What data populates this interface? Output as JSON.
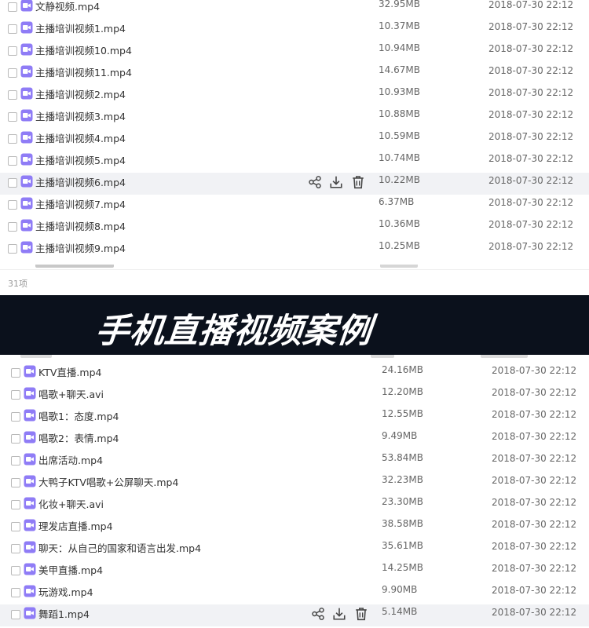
{
  "colors": {
    "file_icon": "#8f7cf6",
    "row_hover": "#f1f2f5",
    "banner_bg": "#0b111c",
    "text_primary": "#333333",
    "text_secondary": "#666666"
  },
  "top_list": {
    "files": [
      {
        "name": "文静视频.mp4",
        "size": "32.95MB",
        "date": "2018-07-30 22:12"
      },
      {
        "name": "主播培训视频1.mp4",
        "size": "10.37MB",
        "date": "2018-07-30 22:12"
      },
      {
        "name": "主播培训视频10.mp4",
        "size": "10.94MB",
        "date": "2018-07-30 22:12"
      },
      {
        "name": "主播培训视频11.mp4",
        "size": "14.67MB",
        "date": "2018-07-30 22:12"
      },
      {
        "name": "主播培训视频2.mp4",
        "size": "10.93MB",
        "date": "2018-07-30 22:12"
      },
      {
        "name": "主播培训视频3.mp4",
        "size": "10.88MB",
        "date": "2018-07-30 22:12"
      },
      {
        "name": "主播培训视频4.mp4",
        "size": "10.59MB",
        "date": "2018-07-30 22:12"
      },
      {
        "name": "主播培训视频5.mp4",
        "size": "10.74MB",
        "date": "2018-07-30 22:12"
      },
      {
        "name": "主播培训视频6.mp4",
        "size": "10.22MB",
        "date": "2018-07-30 22:12",
        "hover": true
      },
      {
        "name": "主播培训视频7.mp4",
        "size": "6.37MB",
        "date": "2018-07-30 22:12"
      },
      {
        "name": "主播培训视频8.mp4",
        "size": "10.36MB",
        "date": "2018-07-30 22:12"
      },
      {
        "name": "主播培训视频9.mp4",
        "size": "10.25MB",
        "date": "2018-07-30 22:12"
      }
    ],
    "item_count": "31项"
  },
  "banner": {
    "title": "手机直播视频案例"
  },
  "bottom_list": {
    "files": [
      {
        "name": "KTV直播.mp4",
        "size": "24.16MB",
        "date": "2018-07-30 22:12"
      },
      {
        "name": "唱歌+聊天.avi",
        "size": "12.20MB",
        "date": "2018-07-30 22:12"
      },
      {
        "name": "唱歌1：态度.mp4",
        "size": "12.55MB",
        "date": "2018-07-30 22:12"
      },
      {
        "name": "唱歌2：表情.mp4",
        "size": "9.49MB",
        "date": "2018-07-30 22:12"
      },
      {
        "name": "出席活动.mp4",
        "size": "53.84MB",
        "date": "2018-07-30 22:12"
      },
      {
        "name": "大鸭子KTV唱歌+公屏聊天.mp4",
        "size": "32.23MB",
        "date": "2018-07-30 22:12"
      },
      {
        "name": "化妆+聊天.avi",
        "size": "23.30MB",
        "date": "2018-07-30 22:12"
      },
      {
        "name": "理发店直播.mp4",
        "size": "38.58MB",
        "date": "2018-07-30 22:12"
      },
      {
        "name": "聊天：从自己的国家和语言出发.mp4",
        "size": "35.61MB",
        "date": "2018-07-30 22:12"
      },
      {
        "name": "美甲直播.mp4",
        "size": "14.25MB",
        "date": "2018-07-30 22:12"
      },
      {
        "name": "玩游戏.mp4",
        "size": "9.90MB",
        "date": "2018-07-30 22:12"
      },
      {
        "name": "舞蹈1.mp4",
        "size": "5.14MB",
        "date": "2018-07-30 22:12",
        "hover": true
      }
    ]
  },
  "icons": {
    "file": "video-file-icon",
    "share": "share-icon",
    "download": "download-icon",
    "delete": "trash-icon",
    "checkbox": "checkbox-icon"
  }
}
